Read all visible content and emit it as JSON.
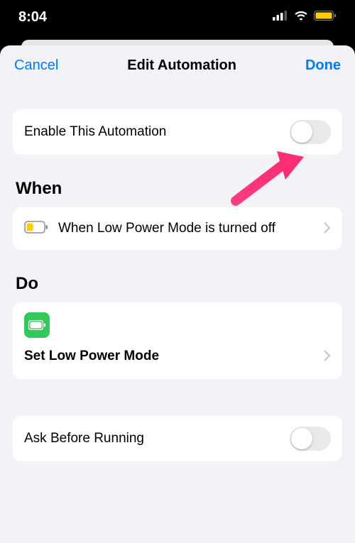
{
  "statusbar": {
    "time": "8:04"
  },
  "navbar": {
    "cancel": "Cancel",
    "title": "Edit Automation",
    "done": "Done"
  },
  "enable_row": {
    "label": "Enable This Automation"
  },
  "when": {
    "heading": "When",
    "item_label": "When Low Power Mode is turned off"
  },
  "do": {
    "heading": "Do",
    "action_label": "Set Low Power Mode"
  },
  "ask_row": {
    "label": "Ask Before Running"
  },
  "colors": {
    "accent": "#007aff",
    "green": "#34c759",
    "arrow": "#ff3b81",
    "battery_fill": "#ffcc00"
  }
}
